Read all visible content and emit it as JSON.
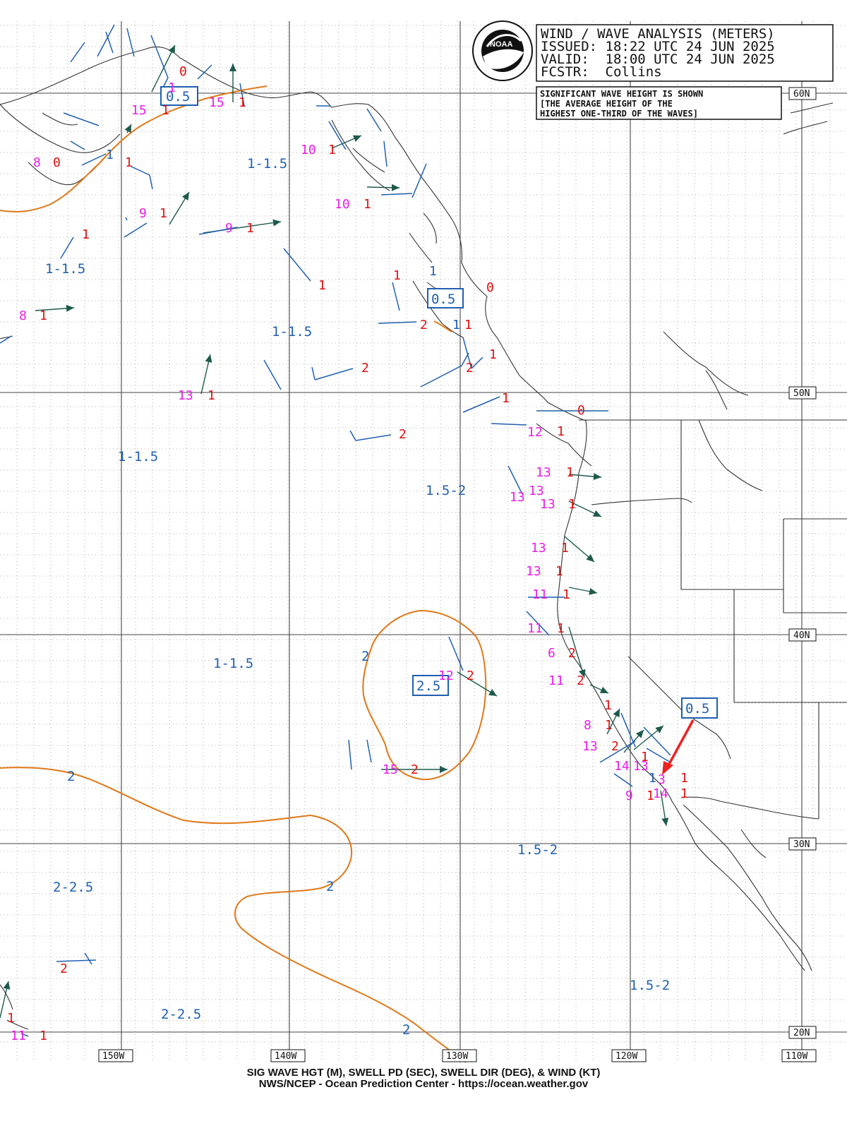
{
  "header": {
    "title": "WIND / WAVE ANALYSIS (METERS)",
    "issued": "ISSUED: 18:22 UTC 24 JUN 2025",
    "valid": "VALID:  18:00 UTC 24 JUN 2025",
    "forecaster": "FCSTR:  Collins",
    "logo_text": "NOAA"
  },
  "note": {
    "line1": "SIGNIFICANT WAVE HEIGHT IS SHOWN",
    "line2": "[THE AVERAGE HEIGHT OF THE",
    "line3": "HIGHEST ONE-THIRD OF THE WAVES]"
  },
  "lat_labels": [
    "60N",
    "50N",
    "40N",
    "30N",
    "20N"
  ],
  "lon_labels": [
    "150W",
    "140W",
    "130W",
    "120W",
    "110W"
  ],
  "footer": {
    "line1": "SIG WAVE HGT (M), SWELL PD (SEC), SWELL DIR (DEG), & WIND (KT)",
    "line2": "NWS/NCEP - Ocean Prediction Center - https://ocean.weather.gov"
  },
  "colors": {
    "grid": "#444444",
    "coast": "#333333",
    "contour": "#e07818",
    "region_text": "#1f5fb0",
    "wind_barb": "#1f5fb0",
    "swell_arrow": "#1d5a4c",
    "period_text": "#e81ee8",
    "height_text": "#dd1111",
    "callout_arrow": "#ee2222"
  },
  "region_labels": [
    "1-1.5",
    "1-1.5",
    "1-1.5",
    "1-1.5",
    "1-1.5",
    "1.5-2",
    "1.5-2",
    "1.5-2",
    "2-2.5",
    "2-2.5"
  ],
  "contour_labels": [
    "2",
    "2",
    "2",
    "2"
  ],
  "boxed_labels": [
    "0.5",
    "0.5",
    "2.5",
    "0.5"
  ],
  "swell_periods": [
    "15",
    "15",
    "8",
    "9",
    "9",
    "8",
    "13",
    "10",
    "10",
    "12",
    "13",
    "13",
    "13",
    "13",
    "13",
    "13",
    "11",
    "11",
    "6",
    "11",
    "8",
    "13",
    "12",
    "15",
    "14",
    "13",
    "9",
    "14",
    "11"
  ],
  "wave_heights": [
    "0",
    "1",
    "0",
    "1",
    "1",
    "1",
    "1",
    "1",
    "1",
    "1",
    "1",
    "2",
    "2",
    "1",
    "0",
    "1",
    "2",
    "1",
    "0",
    "1",
    "1",
    "1",
    "1",
    "1",
    "1",
    "1",
    "2",
    "1",
    "2",
    "1",
    "1",
    "2",
    "2",
    "1",
    "1",
    "1",
    "1",
    "1",
    "2",
    "2",
    "1"
  ],
  "small_labels": [
    "1",
    "1",
    "1",
    "1",
    "3",
    "1",
    "1"
  ]
}
